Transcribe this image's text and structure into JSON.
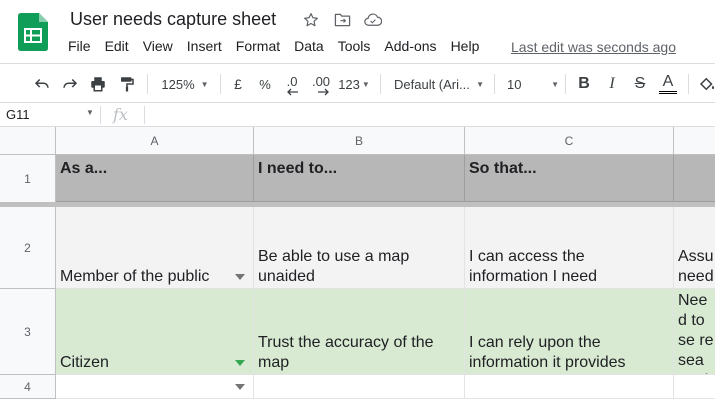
{
  "app": {
    "title": "User needs capture sheet",
    "last_edit": "Last edit was seconds ago"
  },
  "menu": [
    "File",
    "Edit",
    "View",
    "Insert",
    "Format",
    "Data",
    "Tools",
    "Add-ons",
    "Help"
  ],
  "toolbar": {
    "zoom": "125%",
    "currency": "£",
    "percent": "%",
    "dec_decrease": ".0",
    "dec_increase": ".00",
    "more_formats": "123",
    "font": "Default (Ari...",
    "font_size": "10",
    "bold": "B",
    "italic": "I",
    "strikethrough": "S",
    "text_color": "A"
  },
  "formula_bar": {
    "name_box": "G11",
    "fx": "fx",
    "content": ""
  },
  "columns": [
    "A",
    "B",
    "C"
  ],
  "rows": [
    "1",
    "2",
    "3",
    "4"
  ],
  "cells": {
    "r1": {
      "a": "As a...",
      "b": "I need to...",
      "c": "So that...",
      "d": ""
    },
    "r2": {
      "a": "Member of the public",
      "b": "Be able to use a map unaided",
      "c": "I can access the information I need",
      "d": "Assu need"
    },
    "r3": {
      "a": "Citizen",
      "b": "Trust the accuracy of the map",
      "c": "I can rely upon the information it provides",
      "d": "Need to se resea analy"
    },
    "r4": {
      "a": "",
      "b": "",
      "c": "",
      "d": ""
    }
  },
  "colors": {
    "header_row": "#b7b7b7",
    "row2": "#f3f3f3",
    "row3": "#d9ead3",
    "logo_green": "#0f9d58"
  }
}
